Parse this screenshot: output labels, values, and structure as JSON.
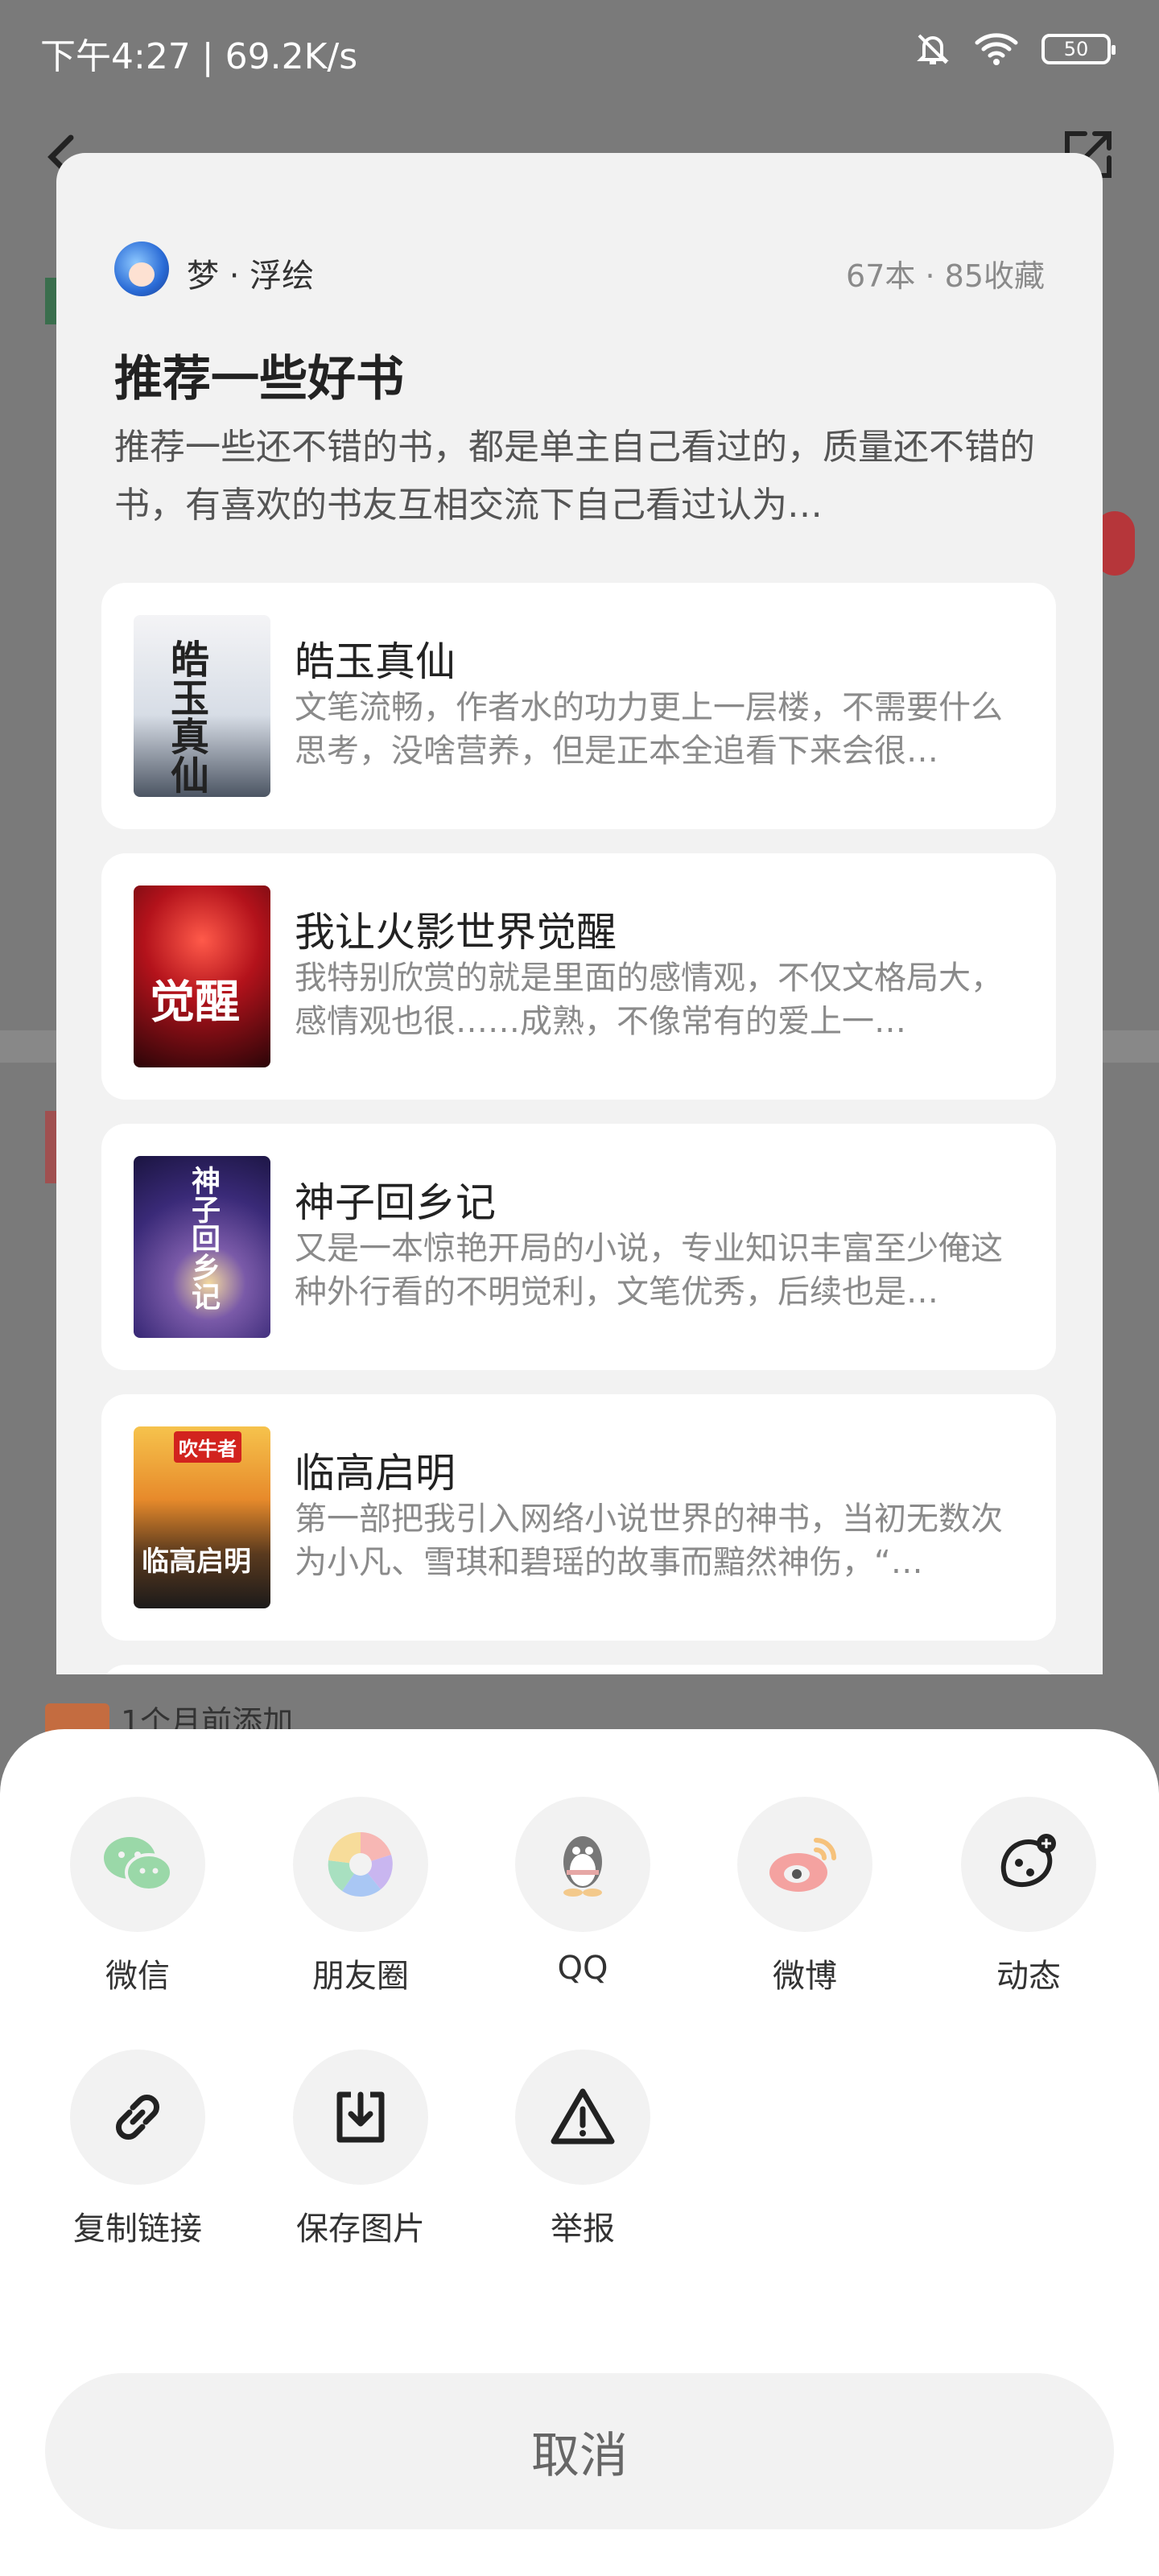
{
  "status_bar": {
    "time": "下午4:27 | 69.2K/s",
    "battery": "50"
  },
  "background": {
    "bottom_hint": "1个月前添加"
  },
  "booklist": {
    "author": "梦 · 浮绘",
    "stats": "67本 · 85收藏",
    "title": "推荐一些好书",
    "description": "推荐一些还不错的书，都是单主自己看过的，质量还不错的书，有喜欢的书友互相交流下自己看过认为…",
    "books": [
      {
        "title": "皓玉真仙",
        "review": "文笔流畅，作者水的功力更上一层楼，不需要什么思考，没啥营养，但是正本全追看下来会很…",
        "cover_text": "皓玉真仙"
      },
      {
        "title": "我让火影世界觉醒",
        "review": "我特别欣赏的就是里面的感情观，不仅文格局大，感情观也很……成熟，不像常有的爱上一…",
        "cover_text": "觉醒"
      },
      {
        "title": "神子回乡记",
        "review": "又是一本惊艳开局的小说，专业知识丰富至少俺这种外行看的不明觉利，文笔优秀，后续也是…",
        "cover_text": "神子回乡记"
      },
      {
        "title": "临高启明",
        "review": "第一部把我引入网络小说世界的神书，当初无数次为小凡、雪琪和碧瑶的故事而黯然神伤，“…",
        "cover_text": "临高启明",
        "cover_badge": "吹牛者"
      }
    ]
  },
  "share_sheet": {
    "row1": [
      {
        "label": "微信",
        "icon": "wechat-icon"
      },
      {
        "label": "朋友圈",
        "icon": "moments-icon"
      },
      {
        "label": "QQ",
        "icon": "qq-icon"
      },
      {
        "label": "微博",
        "icon": "weibo-icon"
      },
      {
        "label": "动态",
        "icon": "post-icon"
      }
    ],
    "row2": [
      {
        "label": "复制链接",
        "icon": "link-icon"
      },
      {
        "label": "保存图片",
        "icon": "download-icon"
      },
      {
        "label": "举报",
        "icon": "warning-icon"
      }
    ],
    "cancel": "取消"
  }
}
